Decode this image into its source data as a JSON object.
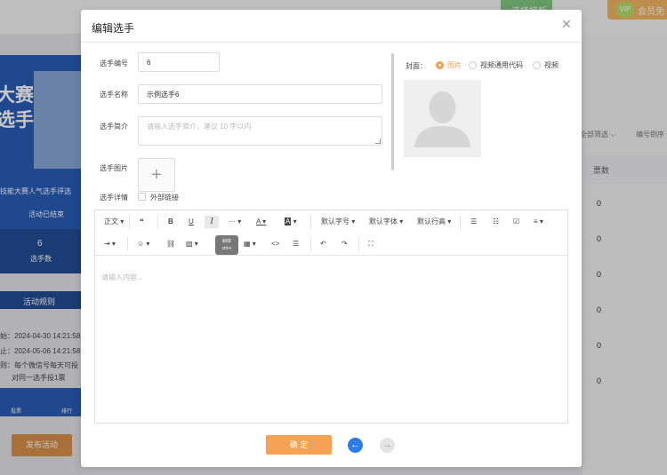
{
  "background": {
    "top_buttons": {
      "template": "选择模板",
      "vip_badge": "VIP",
      "vip": "会员免"
    },
    "filters": [
      "全部筛选 ⌵",
      "编号倒序"
    ],
    "votes_header": "票数",
    "vote_values": [
      "0",
      "0",
      "0",
      "0",
      "0",
      "0"
    ],
    "banner": {
      "title_line1": "大赛",
      "title_line2": "选手",
      "subtitle": "技能大赛人气选手评选",
      "status": "活动已结束",
      "stat_value": "6",
      "stat_label": "选手数",
      "rules": "活动规则",
      "info": [
        "始：2024-04-30 14:21:58",
        "止：2024-05-06 14:21:58",
        "则：每个微信号每天可投",
        "对同一选手投1票"
      ],
      "tabs": [
        "投票",
        "排行"
      ]
    },
    "publish_button": "发布活动"
  },
  "modal": {
    "title": "编辑选手",
    "close_icon": "close-icon",
    "form": {
      "number_label": "选手编号",
      "number_value": "6",
      "name_label": "选手名称",
      "name_value": "示例选手6",
      "intro_label": "选手简介",
      "intro_placeholder": "请输入选手简介，建议 10 字以内",
      "image_label": "选手图片",
      "image_plus": "+",
      "detail_label": "选手详情",
      "external_link": "外部链接"
    },
    "cover": {
      "label": "封面：",
      "options": [
        {
          "label": "图片",
          "selected": true
        },
        {
          "label": "视频通用代码",
          "selected": false
        },
        {
          "label": "视频",
          "selected": false
        }
      ]
    },
    "editor": {
      "toolbar_row1": {
        "paragraph": "正文",
        "quote": "❝",
        "bold": "B",
        "underline": "U",
        "italic": "I",
        "more": "···",
        "font_color": "A",
        "bg_color": "A",
        "font_size": "默认字号",
        "font_family": "默认字体",
        "line_height": "默认行高"
      },
      "tooltip": "斜体\nctrl+i",
      "placeholder": "请输入内容..."
    },
    "confirm_button": "确 定",
    "prev_icon": "arrow-left-icon",
    "next_icon": "arrow-right-icon"
  }
}
